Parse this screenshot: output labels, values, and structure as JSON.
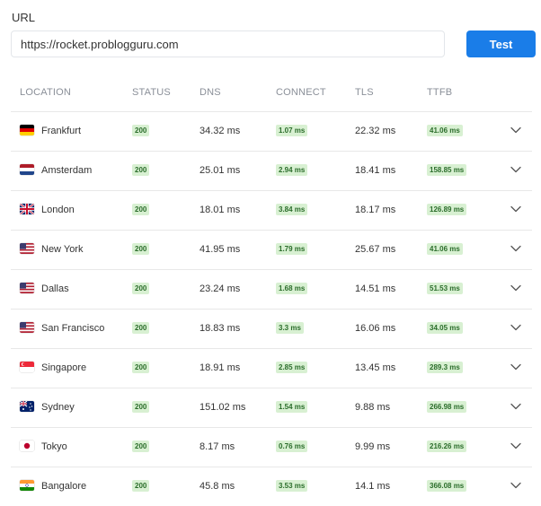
{
  "url_label": "URL",
  "url_value": "https://rocket.problogguru.com",
  "test_button": "Test",
  "columns": {
    "location": "LOCATION",
    "status": "STATUS",
    "dns": "DNS",
    "connect": "CONNECT",
    "tls": "TLS",
    "ttfb": "TTFB"
  },
  "rows": [
    {
      "flag": "germany-flag-icon",
      "location": "Frankfurt",
      "status": "200",
      "dns": "34.32 ms",
      "connect": "1.07 ms",
      "tls": "22.32 ms",
      "ttfb": "41.06 ms"
    },
    {
      "flag": "netherlands-flag-icon",
      "location": "Amsterdam",
      "status": "200",
      "dns": "25.01 ms",
      "connect": "2.94 ms",
      "tls": "18.41 ms",
      "ttfb": "158.85 ms"
    },
    {
      "flag": "uk-flag-icon",
      "location": "London",
      "status": "200",
      "dns": "18.01 ms",
      "connect": "3.84 ms",
      "tls": "18.17 ms",
      "ttfb": "126.89 ms"
    },
    {
      "flag": "us-flag-icon",
      "location": "New York",
      "status": "200",
      "dns": "41.95 ms",
      "connect": "1.79 ms",
      "tls": "25.67 ms",
      "ttfb": "41.06 ms"
    },
    {
      "flag": "us-flag-icon",
      "location": "Dallas",
      "status": "200",
      "dns": "23.24 ms",
      "connect": "1.68 ms",
      "tls": "14.51 ms",
      "ttfb": "51.53 ms"
    },
    {
      "flag": "us-flag-icon",
      "location": "San Francisco",
      "status": "200",
      "dns": "18.83 ms",
      "connect": "3.3 ms",
      "tls": "16.06 ms",
      "ttfb": "34.05 ms"
    },
    {
      "flag": "singapore-flag-icon",
      "location": "Singapore",
      "status": "200",
      "dns": "18.91 ms",
      "connect": "2.85 ms",
      "tls": "13.45 ms",
      "ttfb": "289.3 ms"
    },
    {
      "flag": "australia-flag-icon",
      "location": "Sydney",
      "status": "200",
      "dns": "151.02 ms",
      "connect": "1.54 ms",
      "tls": "9.88 ms",
      "ttfb": "266.98 ms"
    },
    {
      "flag": "japan-flag-icon",
      "location": "Tokyo",
      "status": "200",
      "dns": "8.17 ms",
      "connect": "0.76 ms",
      "tls": "9.99 ms",
      "ttfb": "216.26 ms"
    },
    {
      "flag": "india-flag-icon",
      "location": "Bangalore",
      "status": "200",
      "dns": "45.8 ms",
      "connect": "3.53 ms",
      "tls": "14.1 ms",
      "ttfb": "366.08 ms"
    }
  ]
}
